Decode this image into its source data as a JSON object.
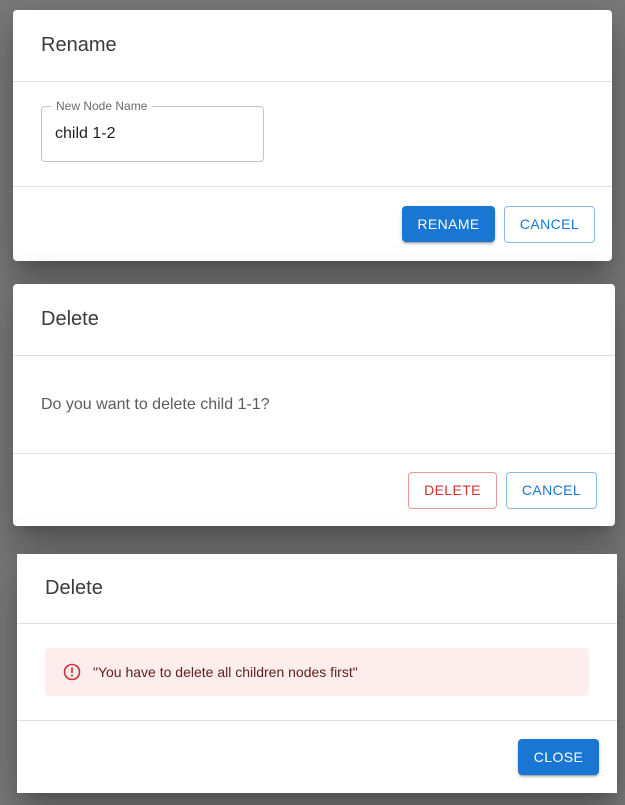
{
  "rename_dialog": {
    "title": "Rename",
    "field_label": "New Node Name",
    "field_value": "child 1-2",
    "rename_label": "RENAME",
    "cancel_label": "CANCEL"
  },
  "delete_dialog": {
    "title": "Delete",
    "message": "Do you want to delete child 1-1?",
    "delete_label": "DELETE",
    "cancel_label": "CANCEL"
  },
  "delete_error_dialog": {
    "title": "Delete",
    "alert_message": "\"You have to delete all children nodes first\"",
    "close_label": "CLOSE"
  },
  "colors": {
    "primary": "#1976d2",
    "error": "#d32f2f",
    "alert_bg": "#fdeded",
    "backdrop": "#7a7a7a"
  },
  "icons": {
    "alert": "error-outline-icon"
  }
}
